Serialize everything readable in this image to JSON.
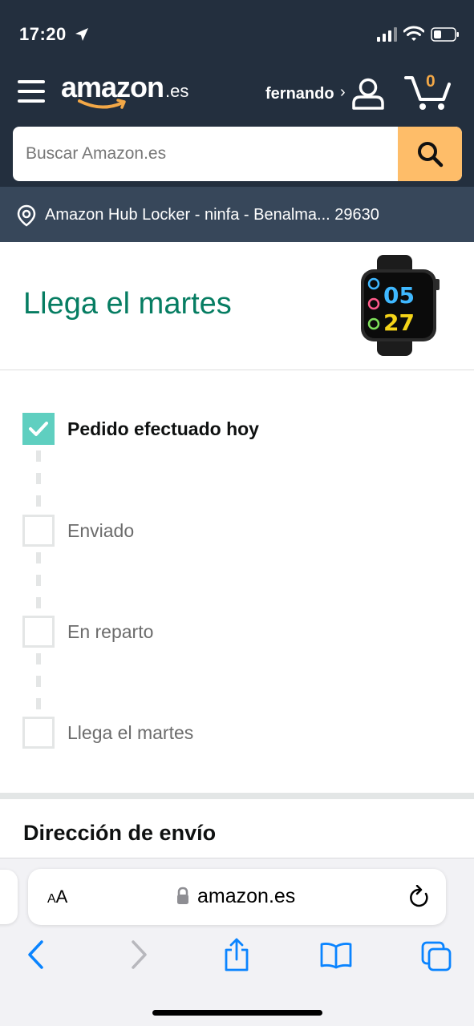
{
  "status_bar": {
    "time": "17:20"
  },
  "header": {
    "logo_main": "amazon",
    "logo_tld": ".es",
    "user_greeting": "fernando",
    "user_chevron": "›",
    "cart_count": "0"
  },
  "search": {
    "placeholder": "Buscar Amazon.es"
  },
  "location": {
    "text": "Amazon Hub Locker - ninfa - Benalma... 29630"
  },
  "delivery": {
    "arrival_title": "Llega el martes",
    "steps": [
      {
        "label": "Pedido efectuado hoy",
        "done": true
      },
      {
        "label": "Enviado",
        "done": false
      },
      {
        "label": "En reparto",
        "done": false
      },
      {
        "label": "Llega el martes",
        "done": false
      }
    ],
    "watch_display": {
      "top": "05",
      "bottom": "27"
    }
  },
  "shipping": {
    "title": "Dirección de envío"
  },
  "browser": {
    "text_size_label_small": "A",
    "text_size_label_large": "A",
    "url": "amazon.es"
  },
  "colors": {
    "header_bg": "#232f3e",
    "location_bg": "#37475a",
    "search_button": "#febd69",
    "arrival_green": "#067d62",
    "check_teal": "#5fcfc0",
    "cart_orange": "#f3a847",
    "safari_blue": "#0a84ff"
  }
}
